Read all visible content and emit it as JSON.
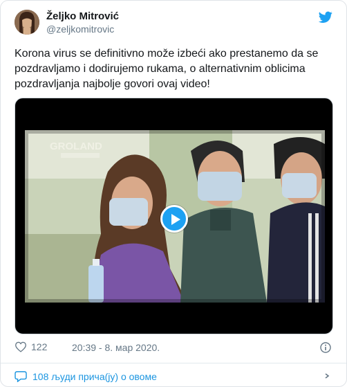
{
  "author": {
    "name": "Željko Mitrović",
    "handle": "@zeljkomitrovic"
  },
  "tweet": {
    "text": "Korona virus se definitivno može izbeći ako prestanemo da se pozdravljamo i dodirujemo rukama, o alternativnim oblicima pozdravljanja najbolje govori ovaj video!"
  },
  "media": {
    "watermark": "GROLAND",
    "play_icon": "play-icon"
  },
  "meta": {
    "likes": "122",
    "timestamp": "20:39 - 8. мар 2020."
  },
  "footer": {
    "people_talking": "108 људи прича(ју) о овоме"
  },
  "colors": {
    "accent": "#1da1f2",
    "link": "#1b95e0",
    "muted": "#657786"
  }
}
